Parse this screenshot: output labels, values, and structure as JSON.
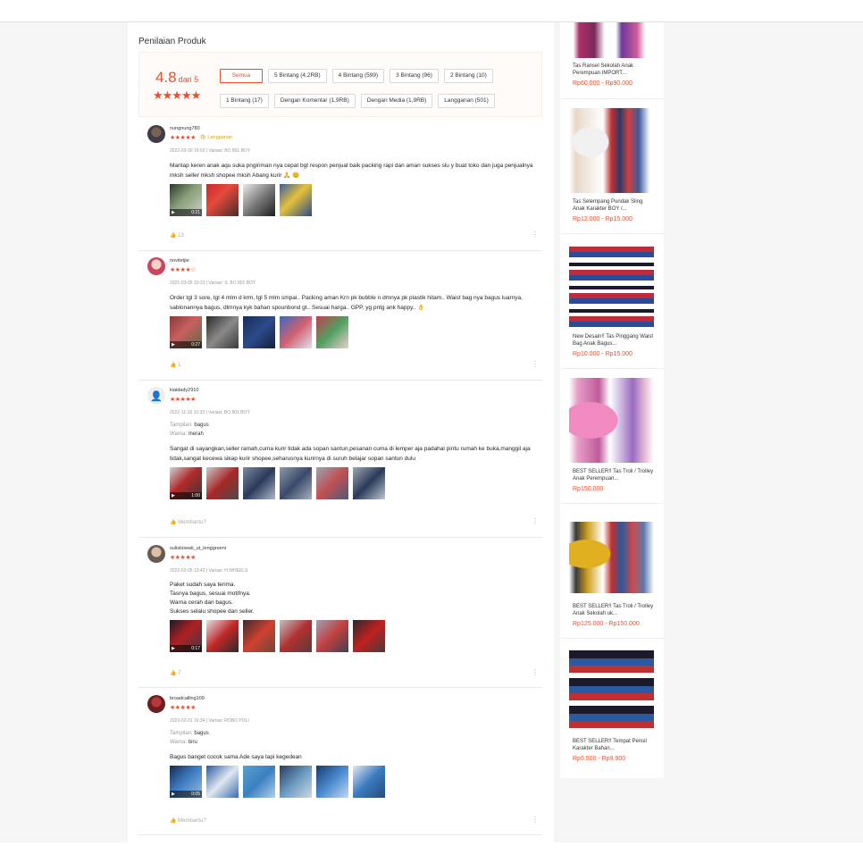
{
  "reviews_section": {
    "title": "Penilaian Produk",
    "score": "4.8",
    "score_suffix": "dari 5",
    "score_stars": "★★★★★",
    "filters_row1": [
      "Semua",
      "5 Bintang (4,2RB)",
      "4 Bintang (599)",
      "3 Bintang (96)",
      "2 Bintang (10)"
    ],
    "filters_row2": [
      "1 Bintang (17)",
      "Dengan Komentar (1,9RB)",
      "Dengan Media (1,9RB)",
      "Langganan (501)"
    ]
  },
  "reviews": [
    {
      "username": "nungnung780",
      "stars": "★★★★★",
      "badge": "Langganan",
      "meta": "2022-03-30 19:02 | Variasi: BO 801 BOY",
      "variants": [],
      "comment": "Mantap keren anak aqu suka pngiriman nya cepat bgt respon penjual baik packing rapi dan aman sukses slu y buat toko dan juga penjualnya mksh seller mksh shopee mksh Abang kurir 🙏 😊",
      "video_duration": "0:21",
      "likes": "13"
    },
    {
      "username": "novitetjie",
      "stars": "★★★★☆",
      "badge": "",
      "meta": "2021-03-05 10:33 | Variasi: S. BO 801 BOY",
      "variants": [],
      "comment": "Order tgl 3 sore, tgl 4 mlm d krm, tgl 5 mlm smpai.. Packing aman Krn pk bubble n dmnya pk plastik hitam.. Waist bag nya bagus luarnya, sablonannya bagus, dlmnya kyk bahan spounbond gt.. Sesuai harga.. GPP, yg pntg ank happy.. 👌",
      "video_duration": "0:27",
      "likes": "1"
    },
    {
      "username": "kiaidady2910",
      "stars": "★★★★★",
      "badge": "",
      "meta": "2022-11-16 10:33 | Variasi: BO 801 BOY",
      "variants": [
        {
          "label": "Tampilan:",
          "value": "bagus"
        },
        {
          "label": "Warna:",
          "value": "merah"
        }
      ],
      "comment": "Sangat di sayangkan,seller ramah,cuma kurir tidak ada sopan santun,pesanan cuma di lemper aja padahal pintu rumah ke buka,manggil aja tidak,sangat kecewa sikap kurir shopee,seharusnya kurirnya di suruh belajar sopan santun dulu",
      "video_duration": "1:00",
      "likes": "Membantu?"
    },
    {
      "username": "sulistiowati_ut_lenggreeni",
      "stars": "★★★★★",
      "badge": "",
      "meta": "2022-02-05 13:42 | Variasi: H.WHEELS",
      "variants": [],
      "comment_lines": [
        "Paket sudah saya terima.",
        "Tasnya bagus, sesuai motifnya.",
        "Warna cerah dan bagus.",
        "Sukses selalu shopee dan seller."
      ],
      "video_duration": "0:17",
      "likes": "7"
    },
    {
      "username": "broadcalling109",
      "stars": "★★★★★",
      "badge": "",
      "meta": "2023-02-01 16:34 | Variasi: ROBO POLI",
      "variants": [
        {
          "label": "Tampilan:",
          "value": "bagus"
        },
        {
          "label": "Warna:",
          "value": "biru"
        }
      ],
      "comment": "Bagus banget cocok sama Ade saya tapi kegedean",
      "video_duration": "0:05",
      "likes": "Membantu?"
    }
  ],
  "sidebar_products": [
    {
      "name": "Tas Ransel Sekolah Anak Perempuan IMPORT...",
      "price": "Rp60.000 - Rp90.000"
    },
    {
      "name": "Tas Selempang Pundak Sling Anak Karakter BOY /...",
      "price": "Rp12.000 - Rp15.000"
    },
    {
      "name": "New Desain!! Tas Pinggang Waist Bag Anak Bagus...",
      "price": "Rp10.000 - Rp15.000"
    },
    {
      "name": "BEST SELLER!! Tas Troli / Trolley Anak Perempuan...",
      "price": "Rp150.000"
    },
    {
      "name": "BEST SELLER!! Tas Troli / Trolley Anak Sekolah uk...",
      "price": "Rp125.000 - Rp150.000"
    },
    {
      "name": "BEST SELLER!! Tempat Pensil Karakter Bahan...",
      "price": "Rp5.500 - Rp9.900"
    }
  ],
  "colors": {
    "accent": "#ee4d2d",
    "star": "#ee4d2d",
    "badge": "#e0a10a"
  },
  "icons": {
    "like": "thumb-up-icon",
    "more": "vertical-dots-icon",
    "video": "video-camera-icon",
    "badge": "shop-bag-icon"
  }
}
